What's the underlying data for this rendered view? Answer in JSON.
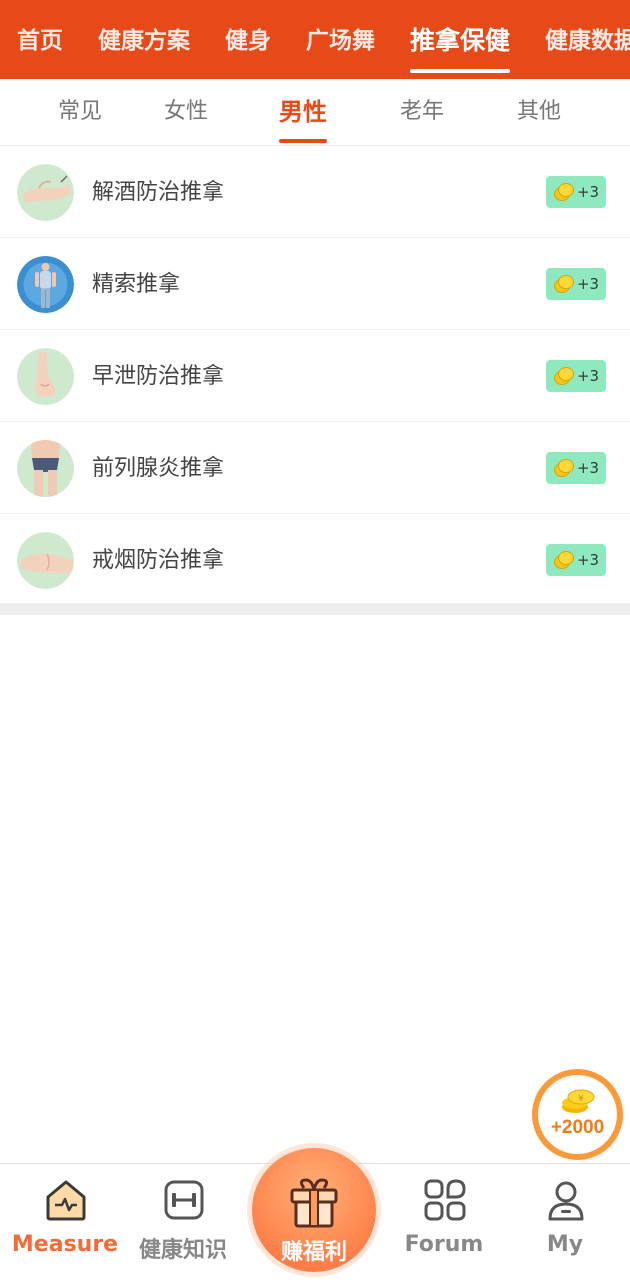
{
  "top_tabs": [
    "首页",
    "健康方案",
    "健身",
    "广场舞",
    "推拿保健",
    "健康数据"
  ],
  "top_active_tab": "推拿保健",
  "sub_tabs": [
    "常见",
    "女性",
    "男性",
    "老年",
    "其他"
  ],
  "sub_active_tab": "男性",
  "list_items": [
    {
      "label": "解酒防治推拿",
      "reward": "+3",
      "thumb_icon": "wrist-photo"
    },
    {
      "label": "精索推拿",
      "reward": "+3",
      "thumb_icon": "man-figure-photo"
    },
    {
      "label": "早泄防治推拿",
      "reward": "+3",
      "thumb_icon": "foot-photo"
    },
    {
      "label": "前列腺炎推拿",
      "reward": "+3",
      "thumb_icon": "torso-photo"
    },
    {
      "label": "戒烟防治推拿",
      "reward": "+3",
      "thumb_icon": "hand-photo"
    }
  ],
  "floating_reward": "+2000",
  "bottom_nav": {
    "measure": "Measure",
    "health_knowledge": "健康知识",
    "earn_rewards": "赚福利",
    "forum": "Forum",
    "my": "My"
  },
  "colors": {
    "brand": "#e64a19",
    "badge_bg": "#8ee9bf",
    "coin": "#f5c518",
    "active_nav": "#f26b3a"
  }
}
